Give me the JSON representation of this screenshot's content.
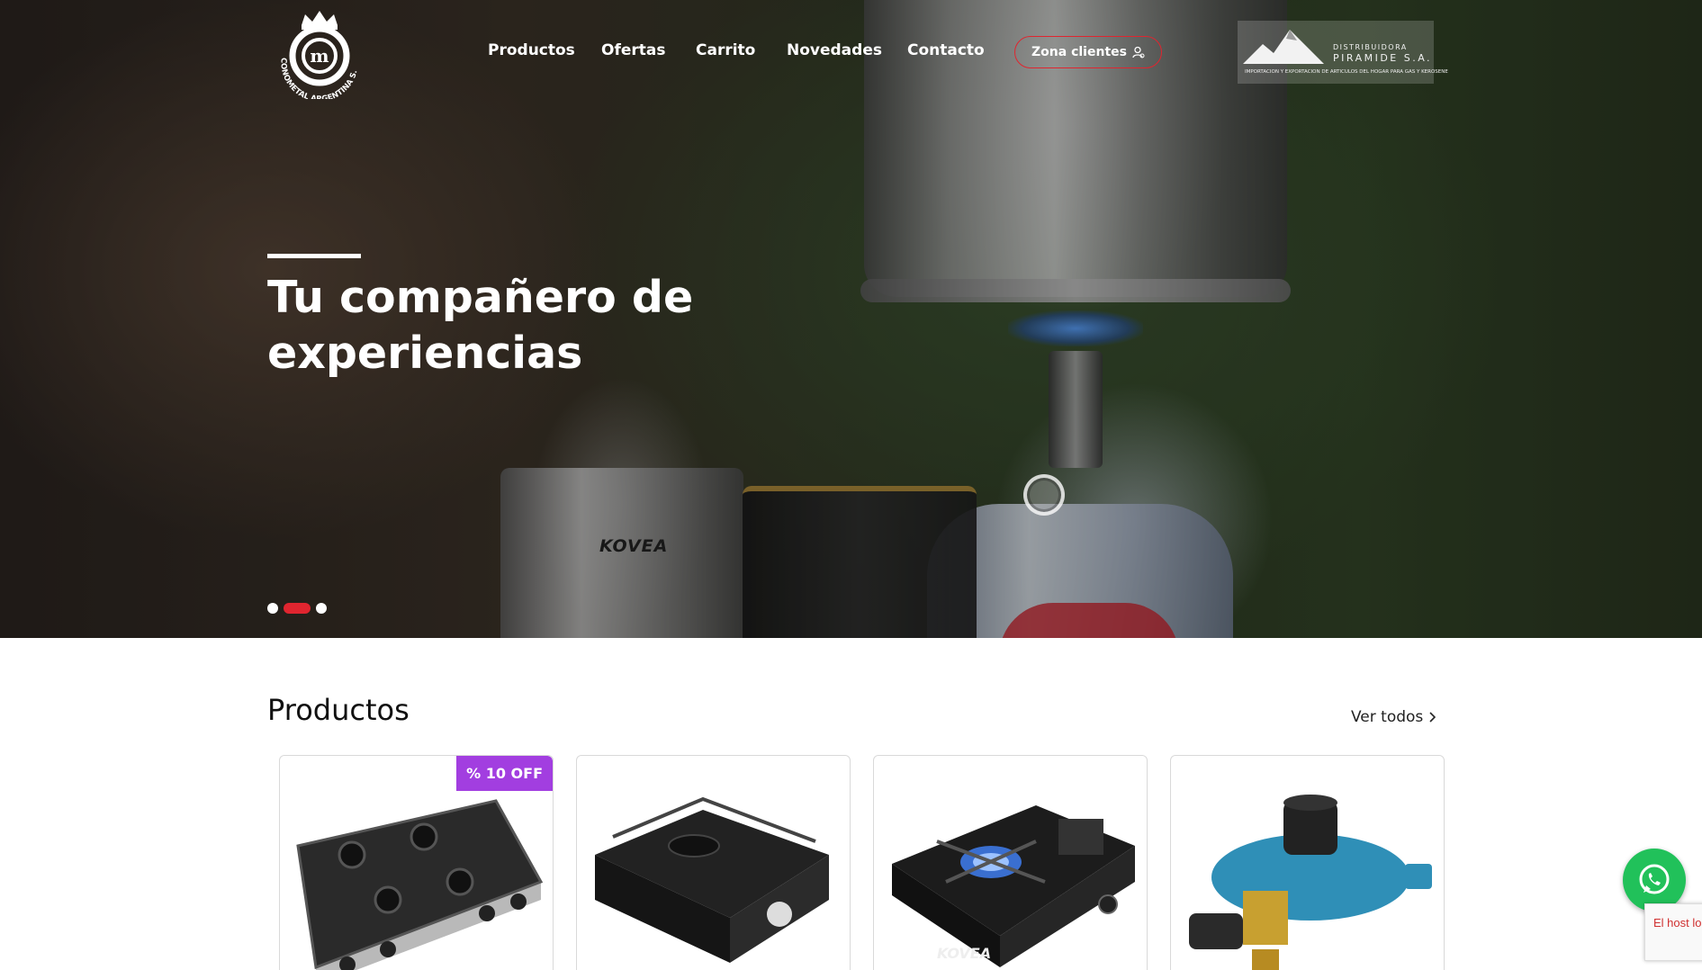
{
  "brand": {
    "logo_alt": "CONOMETAL ARGENTINA S.A.",
    "partner_top": "DISTRIBUIDORA",
    "partner_main": "PIRAMIDE S.A.",
    "partner_sub": "IMPORTACION Y EXPORTACION DE ARTICULOS DEL HOGAR PARA GAS Y KEROSENE"
  },
  "nav": {
    "items": [
      {
        "label": "Productos"
      },
      {
        "label": "Ofertas"
      },
      {
        "label": "Carrito"
      },
      {
        "label": "Novedades"
      },
      {
        "label": "Contacto"
      }
    ],
    "client_button": "Zona clientes"
  },
  "hero": {
    "title_line1": "Tu compañero de",
    "title_line2": "experiencias",
    "product_mark": "KOVEA",
    "slides_total": 3,
    "active_slide": 2
  },
  "products": {
    "title": "Productos",
    "see_all": "Ver todos",
    "items": [
      {
        "badge": "% 10 OFF",
        "image": "four-burner-stove"
      },
      {
        "badge": "",
        "image": "single-burner-stove"
      },
      {
        "badge": "",
        "image": "portable-gas-stove-kovea"
      },
      {
        "badge": "",
        "image": "gas-regulator"
      }
    ]
  },
  "widgets": {
    "whatsapp_icon": "whatsapp-icon",
    "recaptcha_text": "El host lo... lista de d... para esta..."
  },
  "colors": {
    "accent": "#e0252f",
    "badge": "#a23ee0",
    "whatsapp": "#21c15a"
  }
}
